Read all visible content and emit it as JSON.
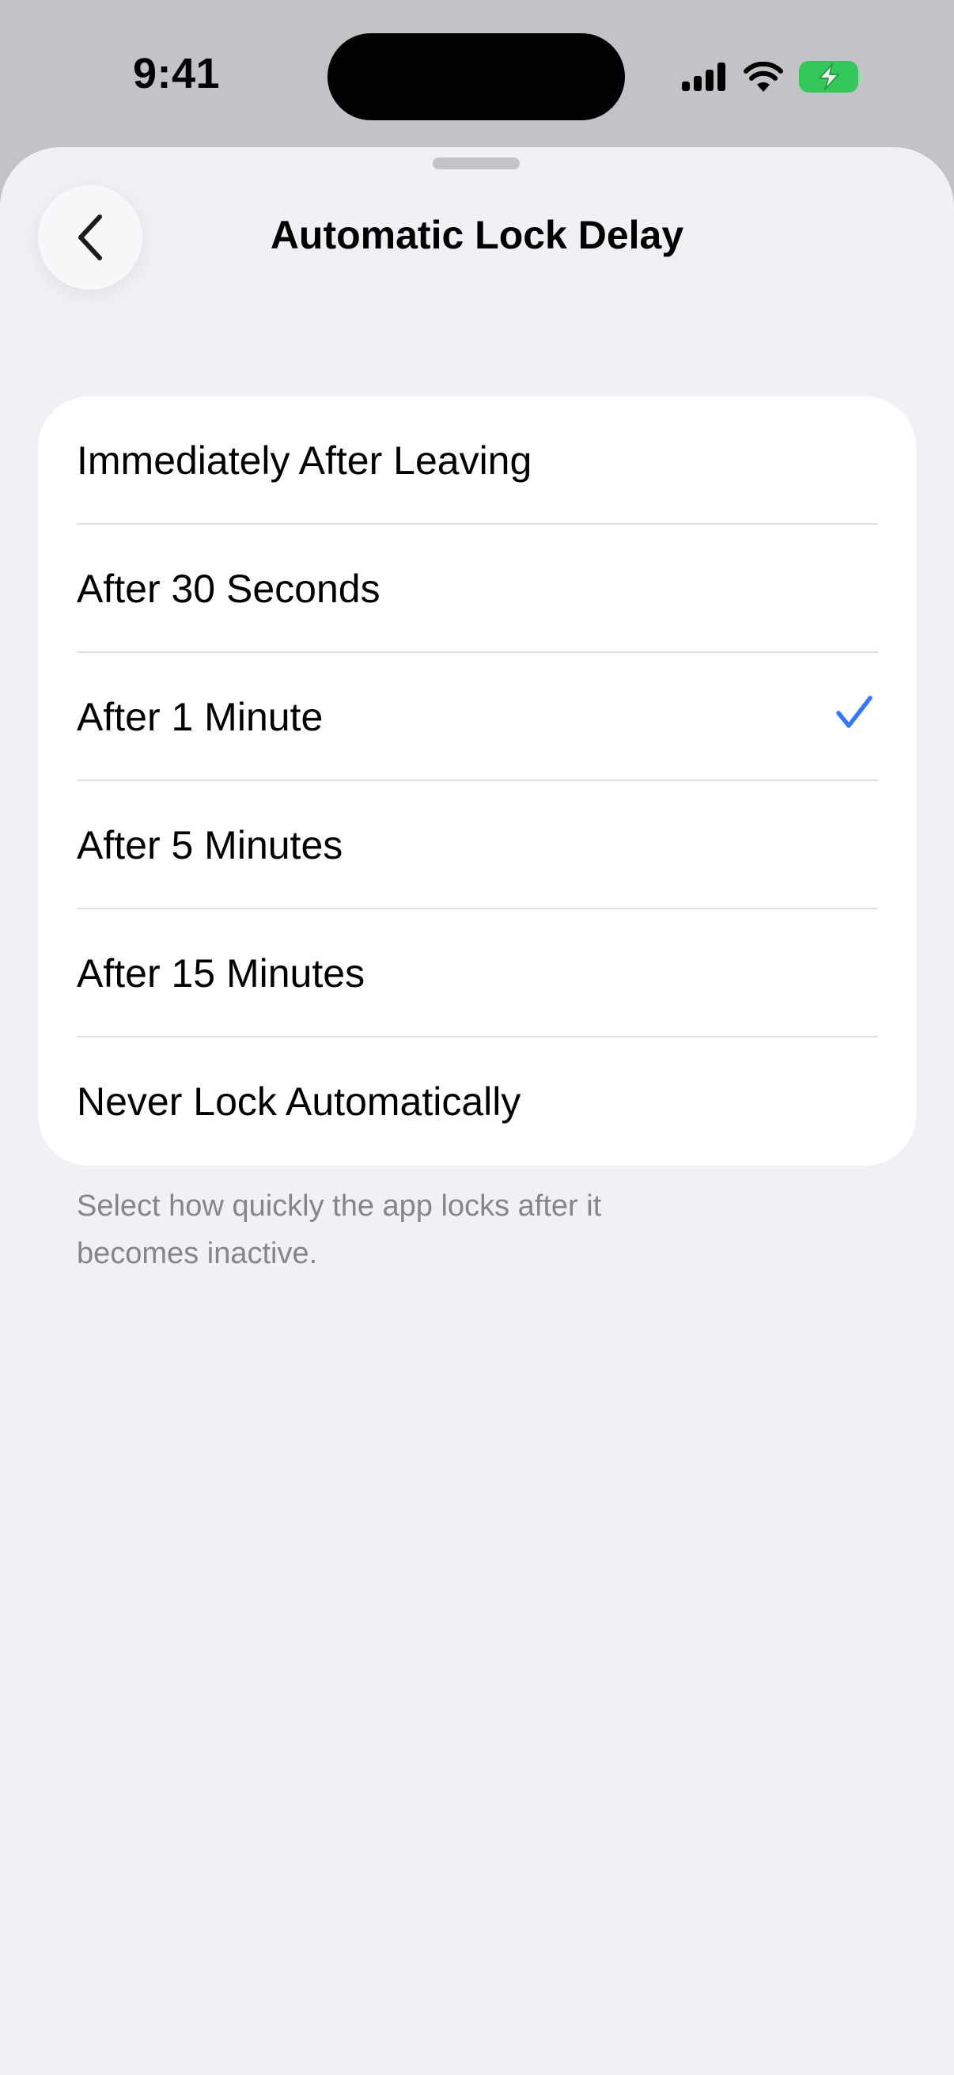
{
  "status_bar": {
    "time": "9:41",
    "icons": [
      "cellular-signal-icon",
      "wifi-icon",
      "battery-charging-icon"
    ],
    "battery_color": "#34c759"
  },
  "sheet": {
    "back_icon": "chevron-left-icon",
    "title": "Automatic Lock Delay",
    "options": [
      {
        "label": "Immediately After Leaving",
        "selected": false
      },
      {
        "label": "After 30 Seconds",
        "selected": false
      },
      {
        "label": "After 1 Minute",
        "selected": true
      },
      {
        "label": "After 5 Minutes",
        "selected": false
      },
      {
        "label": "After 15 Minutes",
        "selected": false
      },
      {
        "label": "Never Lock Automatically",
        "selected": false
      }
    ],
    "check_icon": "checkmark-icon",
    "accent_color": "#3478f6",
    "footer": "Select how quickly the app locks after it becomes inactive."
  }
}
